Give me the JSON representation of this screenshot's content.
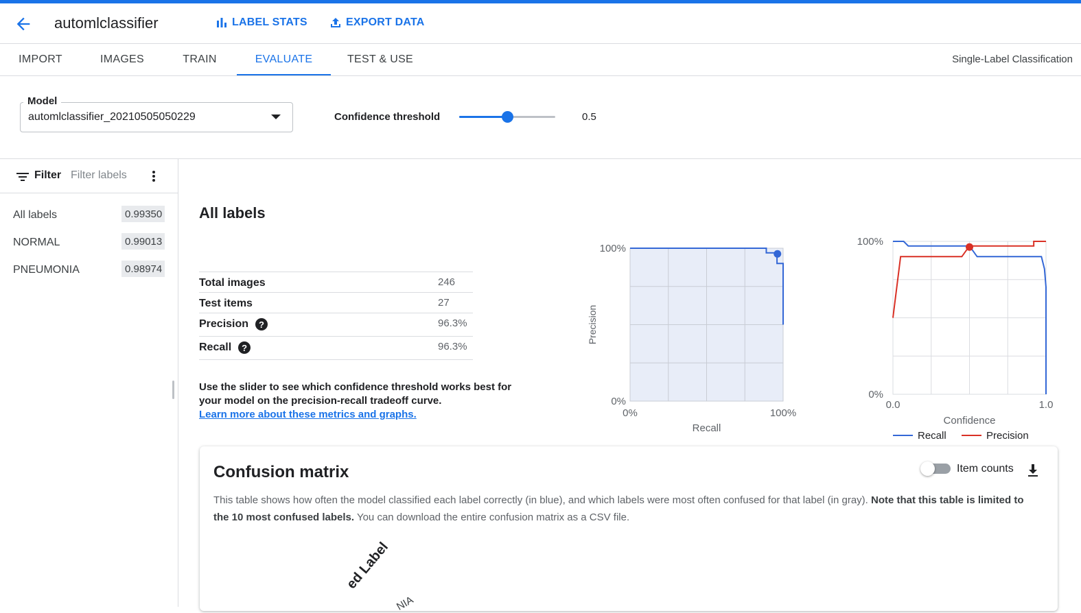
{
  "header": {
    "title": "automlclassifier",
    "label_stats": "LABEL STATS",
    "export_data": "EXPORT DATA"
  },
  "tabs": [
    {
      "label": "IMPORT"
    },
    {
      "label": "IMAGES"
    },
    {
      "label": "TRAIN"
    },
    {
      "label": "EVALUATE",
      "active": true
    },
    {
      "label": "TEST & USE"
    }
  ],
  "mode": "Single-Label Classification",
  "model": {
    "legend": "Model",
    "value": "automlclassifier_20210505050229"
  },
  "threshold": {
    "label": "Confidence threshold",
    "value": "0.5",
    "fraction": 0.5
  },
  "sidebar": {
    "filter_label": "Filter",
    "filter_placeholder": "Filter labels",
    "labels": [
      {
        "name": "All labels",
        "score": "0.99350"
      },
      {
        "name": "NORMAL",
        "score": "0.99013"
      },
      {
        "name": "PNEUMONIA",
        "score": "0.98974"
      }
    ]
  },
  "main": {
    "title": "All labels",
    "stats": [
      {
        "key": "Total images",
        "value": "246"
      },
      {
        "key": "Test items",
        "value": "27"
      },
      {
        "key": "Precision",
        "value": "96.3%"
      },
      {
        "key": "Recall",
        "value": "96.3%"
      }
    ],
    "explain": "Use the slider to see which confidence threshold works best for your model on the precision-recall tradeoff curve.",
    "learn_link": "Learn more about these metrics and graphs."
  },
  "chart_data": [
    {
      "type": "line",
      "xlabel": "Recall",
      "ylabel": "Precision",
      "xticks": [
        "0%",
        "100%"
      ],
      "yticks": [
        "0%",
        "100%"
      ],
      "xlim": [
        0,
        1
      ],
      "ylim": [
        0,
        1
      ],
      "grid": true,
      "series": [
        {
          "values": [
            [
              0.0,
              1.0
            ],
            [
              0.89,
              1.0
            ],
            [
              0.89,
              0.97
            ],
            [
              0.96,
              0.97
            ],
            [
              0.96,
              0.9
            ],
            [
              1.0,
              0.9
            ],
            [
              1.0,
              0.5
            ]
          ]
        }
      ],
      "marker": [
        0.963,
        0.963
      ],
      "colors": {
        "line": "#3367d6",
        "fill": "#e8edf8",
        "marker": "#3367d6"
      }
    },
    {
      "type": "line",
      "xlabel": "Confidence",
      "xticks": [
        "0.0",
        "1.0"
      ],
      "yticks": [
        "0%",
        "100%"
      ],
      "xlim": [
        0,
        1
      ],
      "ylim": [
        0,
        1
      ],
      "grid": true,
      "legend_position": "bottom",
      "series": [
        {
          "name": "Recall",
          "color": "#3367d6",
          "values": [
            [
              0.0,
              1.0
            ],
            [
              0.07,
              1.0
            ],
            [
              0.1,
              0.97
            ],
            [
              0.5,
              0.97
            ],
            [
              0.55,
              0.9
            ],
            [
              0.97,
              0.9
            ],
            [
              0.99,
              0.82
            ],
            [
              1.0,
              0.7
            ],
            [
              1.0,
              0.0
            ]
          ]
        },
        {
          "name": "Precision",
          "color": "#d93025",
          "values": [
            [
              0.0,
              0.5
            ],
            [
              0.05,
              0.9
            ],
            [
              0.45,
              0.9
            ],
            [
              0.5,
              0.97
            ],
            [
              0.92,
              0.97
            ],
            [
              0.92,
              1.0
            ],
            [
              1.0,
              1.0
            ]
          ]
        }
      ],
      "marker": [
        0.5,
        0.963
      ]
    }
  ],
  "confusion": {
    "title": "Confusion matrix",
    "toggle_label": "Item counts",
    "desc_part1": "This table shows how often the model classified each label correctly (in blue), and which labels were most often confused for that label (in gray). ",
    "desc_bold": "Note that this table is limited to the 10 most confused labels.",
    "desc_part2": " You can download the entire confusion matrix as a CSV file.",
    "axis_label": "ed Label",
    "col_label": "NIA"
  }
}
